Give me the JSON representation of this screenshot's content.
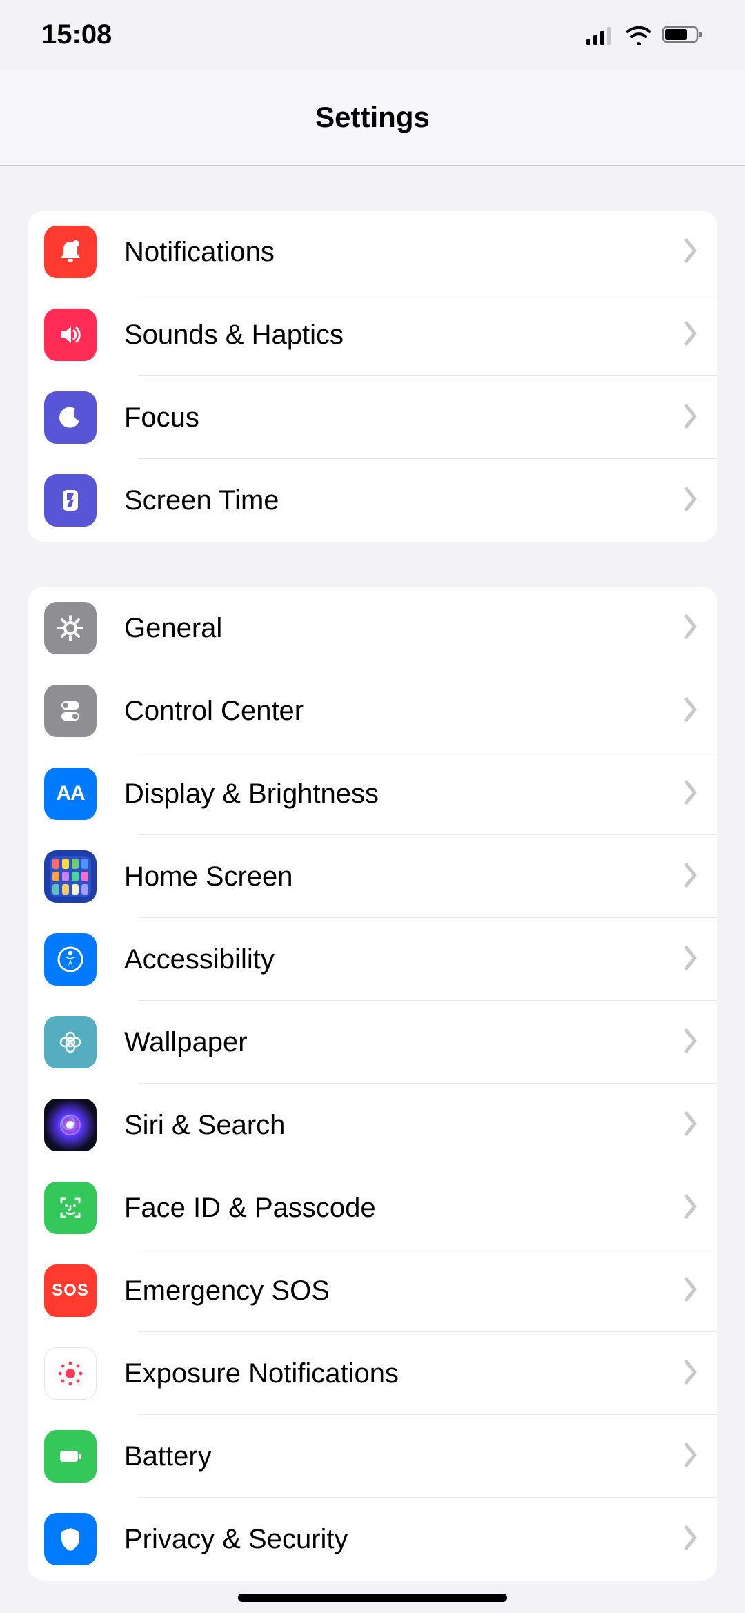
{
  "status": {
    "time": "15:08"
  },
  "header": {
    "title": "Settings"
  },
  "groups": [
    {
      "items": [
        {
          "id": "notifications",
          "label": "Notifications",
          "icon": "notifications-icon",
          "color": "ic-notifications"
        },
        {
          "id": "sounds",
          "label": "Sounds & Haptics",
          "icon": "sounds-icon",
          "color": "ic-sounds"
        },
        {
          "id": "focus",
          "label": "Focus",
          "icon": "focus-icon",
          "color": "ic-focus"
        },
        {
          "id": "screentime",
          "label": "Screen Time",
          "icon": "screentime-icon",
          "color": "ic-screentime"
        }
      ]
    },
    {
      "items": [
        {
          "id": "general",
          "label": "General",
          "icon": "general-icon",
          "color": "ic-general"
        },
        {
          "id": "controlcenter",
          "label": "Control Center",
          "icon": "controlcenter-icon",
          "color": "ic-controlcenter"
        },
        {
          "id": "display",
          "label": "Display & Brightness",
          "icon": "display-icon",
          "color": "ic-display"
        },
        {
          "id": "homescreen",
          "label": "Home Screen",
          "icon": "homescreen-icon",
          "color": "ic-homescreen"
        },
        {
          "id": "accessibility",
          "label": "Accessibility",
          "icon": "accessibility-icon",
          "color": "ic-accessibility"
        },
        {
          "id": "wallpaper",
          "label": "Wallpaper",
          "icon": "wallpaper-icon",
          "color": "ic-wallpaper"
        },
        {
          "id": "siri",
          "label": "Siri & Search",
          "icon": "siri-icon",
          "color": "ic-siri"
        },
        {
          "id": "faceid",
          "label": "Face ID & Passcode",
          "icon": "faceid-icon",
          "color": "ic-faceid"
        },
        {
          "id": "sos",
          "label": "Emergency SOS",
          "icon": "sos-icon",
          "color": "ic-sos"
        },
        {
          "id": "exposure",
          "label": "Exposure Notifications",
          "icon": "exposure-icon",
          "color": "ic-exposure"
        },
        {
          "id": "battery",
          "label": "Battery",
          "icon": "battery-icon",
          "color": "ic-battery"
        },
        {
          "id": "privacy",
          "label": "Privacy & Security",
          "icon": "privacy-icon",
          "color": "ic-privacy"
        }
      ]
    }
  ],
  "sos_text": "SOS"
}
